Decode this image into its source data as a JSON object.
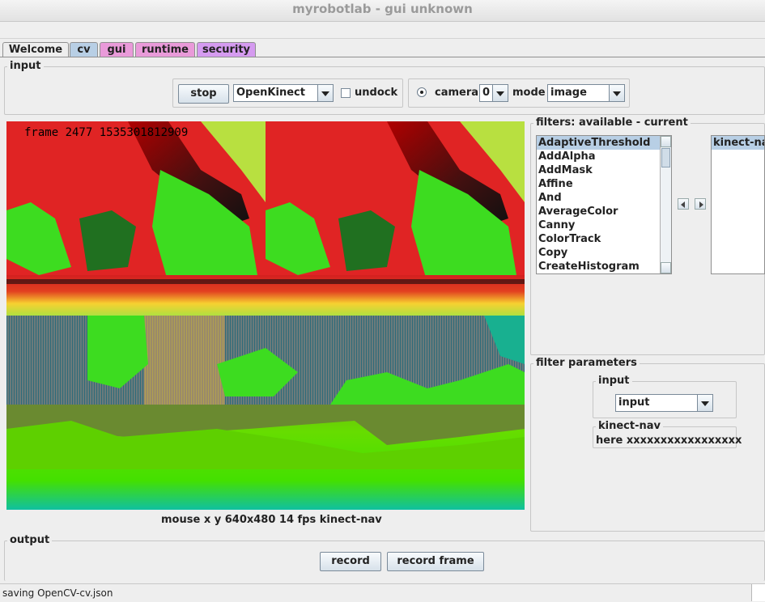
{
  "window": {
    "title": "myrobotlab - gui unknown"
  },
  "tabs": [
    {
      "label": "Welcome",
      "color": "#eeeeee"
    },
    {
      "label": "cv",
      "color": "#b8cfe5"
    },
    {
      "label": "gui",
      "color": "#e99ad9"
    },
    {
      "label": "runtime",
      "color": "#e99ad9"
    },
    {
      "label": "security",
      "color": "#d59bf0"
    }
  ],
  "input": {
    "legend": "input",
    "stop_label": "stop",
    "grabber_selected": "OpenKinect",
    "undock_label": "undock",
    "undock_checked": false,
    "camera_label": "camera",
    "camera_index": "0",
    "mode_label": "mode",
    "mode_selected": "image"
  },
  "video": {
    "overlay_text": "frame 2477 1535301812909",
    "status": "mouse x y 640x480 14 fps kinect-nav"
  },
  "filters": {
    "legend": "filters: available - current",
    "available": [
      "AdaptiveThreshold",
      "AddAlpha",
      "AddMask",
      "Affine",
      "And",
      "AverageColor",
      "Canny",
      "ColorTrack",
      "Copy",
      "CreateHistogram"
    ],
    "selected_available": "AdaptiveThreshold",
    "current": [
      "kinect-nav"
    ]
  },
  "filter_parameters": {
    "legend": "filter parameters",
    "input_legend": "input",
    "input_selected": "input",
    "kinect_legend": "kinect-nav",
    "kinect_text": "here xxxxxxxxxxxxxxxxx"
  },
  "output": {
    "legend": "output",
    "record_label": "record",
    "record_frame_label": "record frame"
  },
  "status": {
    "text": "saving OpenCV-cv.json"
  }
}
